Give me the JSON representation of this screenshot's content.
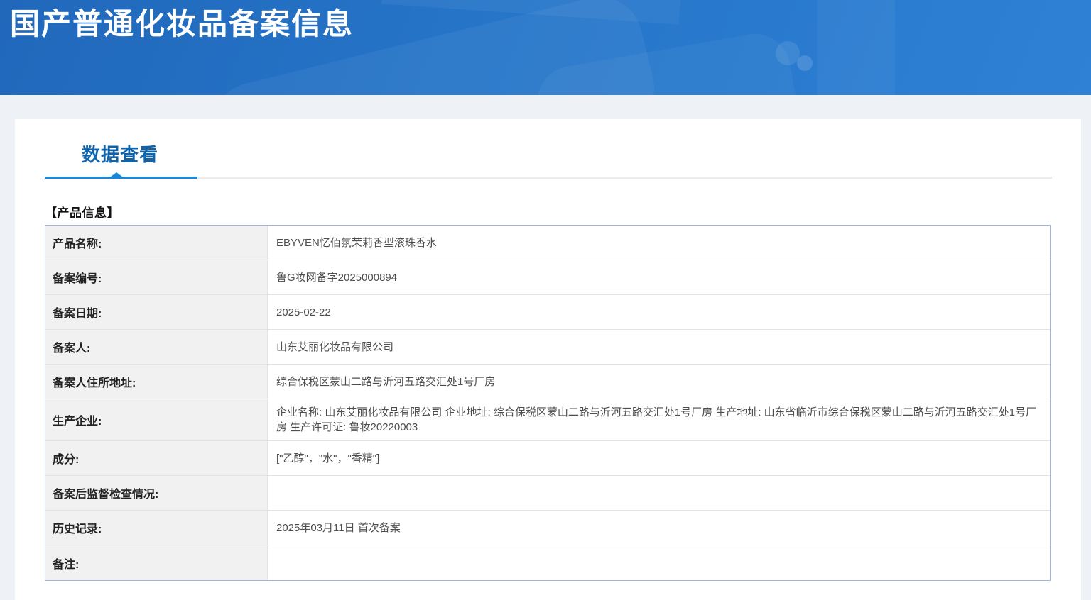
{
  "header": {
    "title": "国产普通化妆品备案信息"
  },
  "tabs": {
    "data_view": "数据查看"
  },
  "section": {
    "product_info_title": "【产品信息】"
  },
  "table": {
    "rows": [
      {
        "label": "产品名称:",
        "value": "EBYVEN忆佰氛茉莉香型滚珠香水"
      },
      {
        "label": "备案编号:",
        "value": "鲁G妆网备字2025000894"
      },
      {
        "label": "备案日期:",
        "value": "2025-02-22"
      },
      {
        "label": "备案人:",
        "value": "山东艾丽化妆品有限公司"
      },
      {
        "label": "备案人住所地址:",
        "value": "综合保税区蒙山二路与沂河五路交汇处1号厂房"
      },
      {
        "label": "生产企业:",
        "value": "企业名称: 山东艾丽化妆品有限公司 企业地址: 综合保税区蒙山二路与沂河五路交汇处1号厂房 生产地址: 山东省临沂市综合保税区蒙山二路与沂河五路交汇处1号厂房 生产许可证: 鲁妆20220003"
      },
      {
        "label": "成分:",
        "value": "[\"乙醇\"，\"水\"，\"香精\"]"
      },
      {
        "label": "备案后监督检查情况:",
        "value": ""
      },
      {
        "label": "历史记录:",
        "value": "2025年03月11日 首次备案"
      },
      {
        "label": "备注:",
        "value": ""
      }
    ]
  },
  "colors": {
    "banner_gradient_start": "#2168bb",
    "banner_gradient_end": "#2e81d5",
    "page_background": "#eef1f5",
    "tab_text": "#0e63ab",
    "tab_underline_active": "#1b87d8",
    "table_border": "#9cb6df",
    "label_cell_background": "#f1f1f1"
  }
}
